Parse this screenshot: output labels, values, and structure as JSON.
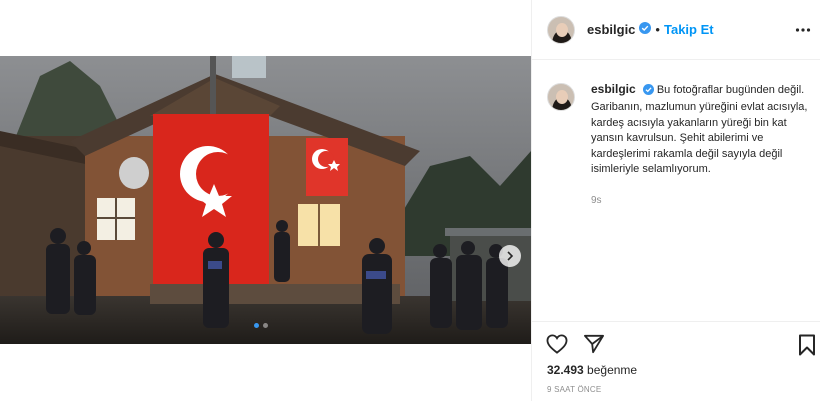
{
  "post": {
    "username": "esbilgic",
    "follow_label": "Takip Et",
    "separator": "•",
    "caption": "Bu fotoğraflar bugünden değil. Garibanın, mazlumun yüreğini evlat acısıyla, kardeş acısıyla yakanların yüreği bin kat yansın kavrulsun. Şehit abilerimi ve kardeşlerimi rakamla değil sayıyla değil isimleriyle selamlıyorum.",
    "caption_time": "9s",
    "likes_count": "32.493",
    "likes_label": "beğenme",
    "posted_ago": "9 SAAT ÖNCE"
  },
  "media": {
    "slide_count": 2,
    "active_slide": 1,
    "description_icons": [
      "turkish-flag",
      "house",
      "people"
    ]
  },
  "colors": {
    "accent_blue": "#0095f6",
    "flag_red": "#d9261c",
    "text": "#262626",
    "muted": "#8e8e8e"
  },
  "icons": {
    "verified": "verified-badge-icon",
    "more": "more-options-icon",
    "like": "heart-icon",
    "share": "paper-plane-icon",
    "save": "bookmark-icon",
    "next": "chevron-right-icon"
  }
}
